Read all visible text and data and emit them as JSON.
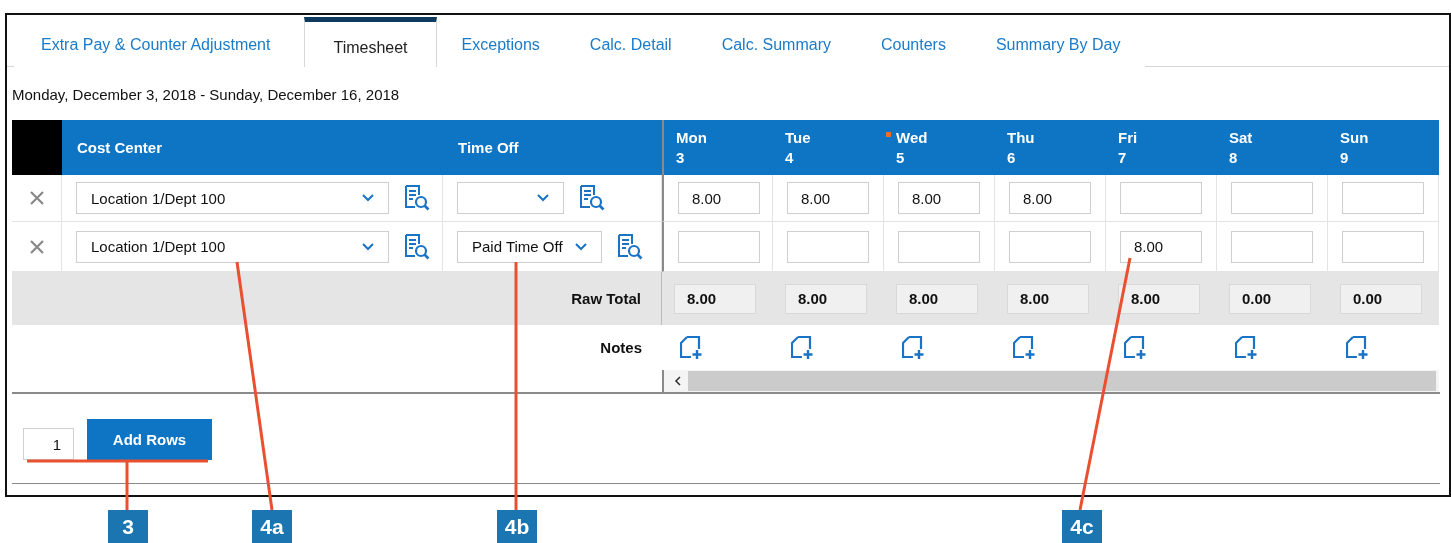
{
  "tabs": [
    {
      "label": "Extra Pay & Counter Adjustment",
      "selected": false
    },
    {
      "label": "Timesheet",
      "selected": true
    },
    {
      "label": "Exceptions",
      "selected": false
    },
    {
      "label": "Calc. Detail",
      "selected": false
    },
    {
      "label": "Calc. Summary",
      "selected": false
    },
    {
      "label": "Counters",
      "selected": false
    },
    {
      "label": "Summary By Day",
      "selected": false
    }
  ],
  "date_range": "Monday, December 3, 2018 - Sunday, December 16, 2018",
  "table": {
    "columns": [
      "Cost Center",
      "Time Off"
    ],
    "days": [
      {
        "weekday": "Mon",
        "date": "3",
        "flagged": false
      },
      {
        "weekday": "Tue",
        "date": "4",
        "flagged": false
      },
      {
        "weekday": "Wed",
        "date": "5",
        "flagged": true
      },
      {
        "weekday": "Thu",
        "date": "6",
        "flagged": false
      },
      {
        "weekday": "Fri",
        "date": "7",
        "flagged": false
      },
      {
        "weekday": "Sat",
        "date": "8",
        "flagged": false
      },
      {
        "weekday": "Sun",
        "date": "9",
        "flagged": false
      }
    ],
    "rows": [
      {
        "cost_center": "Location 1/Dept 100",
        "hours": {
          "mon": "8.00",
          "tue": "8.00",
          "wed": "8.00",
          "thu": "8.00"
        }
      },
      {
        "cost_center": "Location 1/Dept 100",
        "time_off": "Paid Time Off",
        "hours": {
          "fri": "8.00"
        }
      }
    ],
    "raw_total": {
      "label": "Raw Total",
      "values": [
        "8.00",
        "8.00",
        "8.00",
        "8.00",
        "8.00",
        "0.00",
        "0.00"
      ]
    },
    "notes_label": "Notes"
  },
  "add_rows": {
    "count": "1",
    "button": "Add Rows"
  },
  "callouts": [
    {
      "label": "3"
    },
    {
      "label": "4a"
    },
    {
      "label": "4b"
    },
    {
      "label": "4c"
    }
  ]
}
